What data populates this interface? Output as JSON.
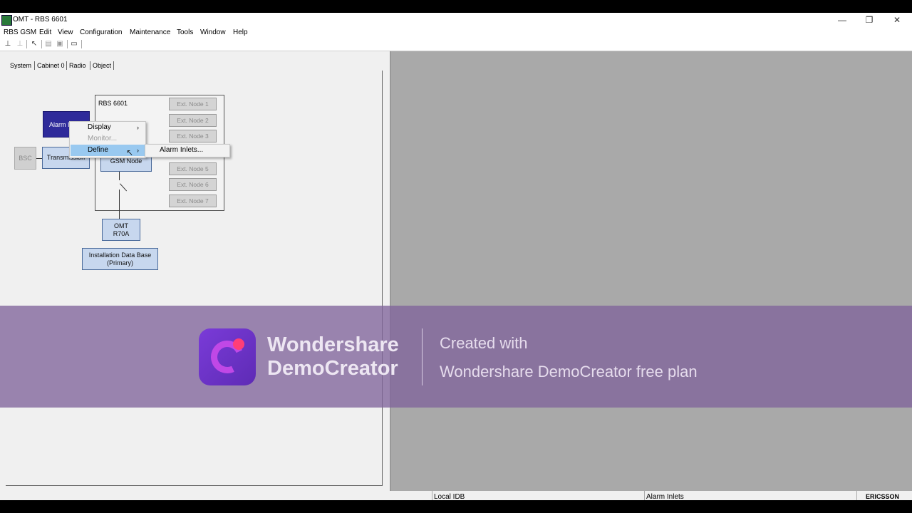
{
  "window": {
    "title": "OMT - RBS 6601",
    "controls": {
      "minimize": "—",
      "restore": "❐",
      "close": "✕"
    }
  },
  "menubar": [
    "RBS GSM",
    "Edit",
    "View",
    "Configuration",
    "Maintenance",
    "Tools",
    "Window",
    "Help"
  ],
  "toolbar": {
    "icons": [
      "connect-icon",
      "disconnect-icon",
      "tool-icon",
      "book-icon",
      "save-icon",
      "monitor-icon"
    ]
  },
  "tabs": [
    "System",
    "Cabinet 0",
    "Radio",
    "Object"
  ],
  "diagram": {
    "rbs_title": "RBS 6601",
    "ext_nodes": [
      "Ext. Node 1",
      "Ext. Node 2",
      "Ext. Node 3",
      "Ext. Node 5",
      "Ext. Node 6",
      "Ext. Node 7"
    ],
    "alarm_label": "Alarm I",
    "bsc": "BSC",
    "transmission": "Transmission",
    "gsm_node": "GSM Node",
    "omt_line1": "OMT",
    "omt_line2": "R70A",
    "idb_line1": "Installation Data Base",
    "idb_line2": "(Primary)"
  },
  "context_menu": {
    "items": [
      {
        "label": "Display",
        "enabled": true,
        "submenu": true
      },
      {
        "label": "Monitor...",
        "enabled": false,
        "submenu": false
      },
      {
        "label": "Define",
        "enabled": true,
        "submenu": true,
        "highlighted": true
      }
    ],
    "submenu": {
      "label": "Alarm Inlets..."
    }
  },
  "watermark": {
    "brand_line1": "Wondershare",
    "brand_line2": "DemoCreator",
    "created_with": "Created with",
    "plan": "Wondershare DemoCreator free plan"
  },
  "statusbar": {
    "idb": "Local IDB",
    "status": "Alarm Inlets",
    "brand": "ERICSSON"
  },
  "colors": {
    "alarm_node": "#2e2a9a",
    "node_fill": "#c7d7ee",
    "menu_highlight": "#99c9f0",
    "watermark": "#80649b"
  }
}
